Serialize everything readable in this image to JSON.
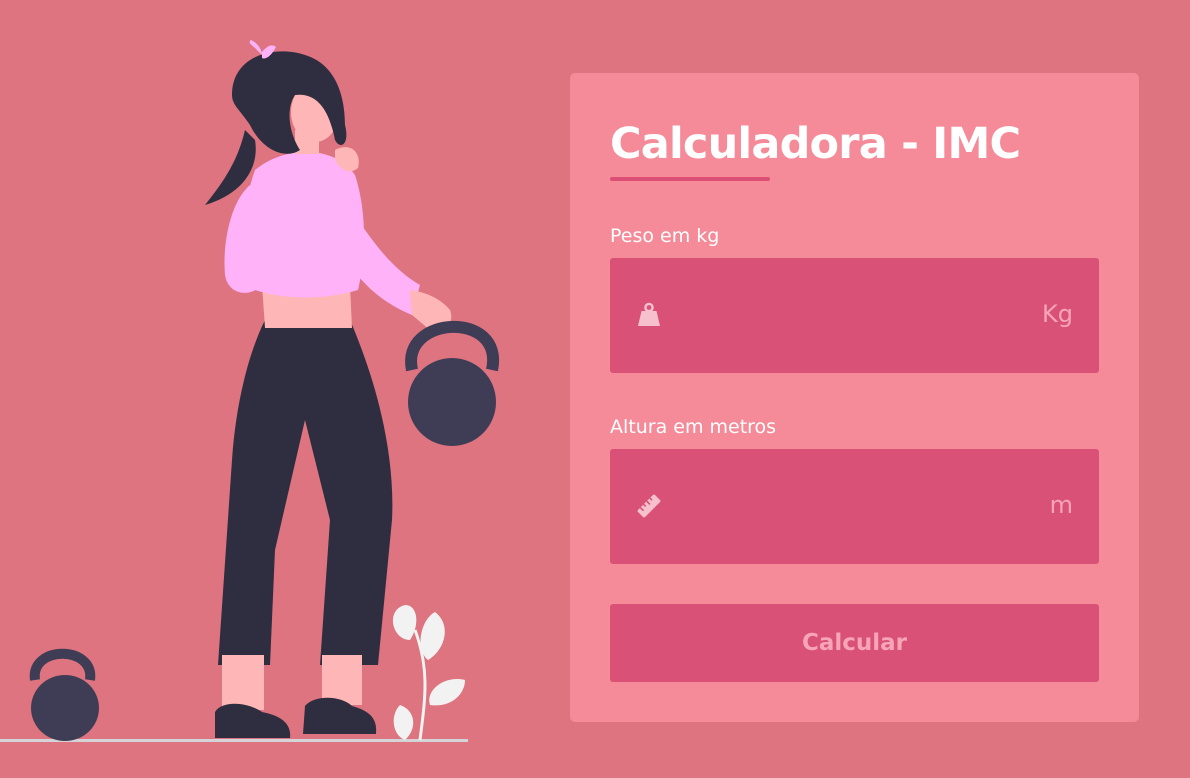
{
  "calculator": {
    "title": "Calculadora - IMC",
    "weight": {
      "label": "Peso em kg",
      "value": "",
      "unit": "Kg",
      "icon": "weight-icon"
    },
    "height": {
      "label": "Altura em metros",
      "value": "",
      "unit": "m",
      "icon": "ruler-icon"
    },
    "button_label": "Calcular"
  },
  "colors": {
    "background": "#dd747f",
    "card": "#f58b99",
    "accent": "#d95176",
    "text_light": "#ffffff",
    "muted_pink": "#f6a4b6"
  }
}
